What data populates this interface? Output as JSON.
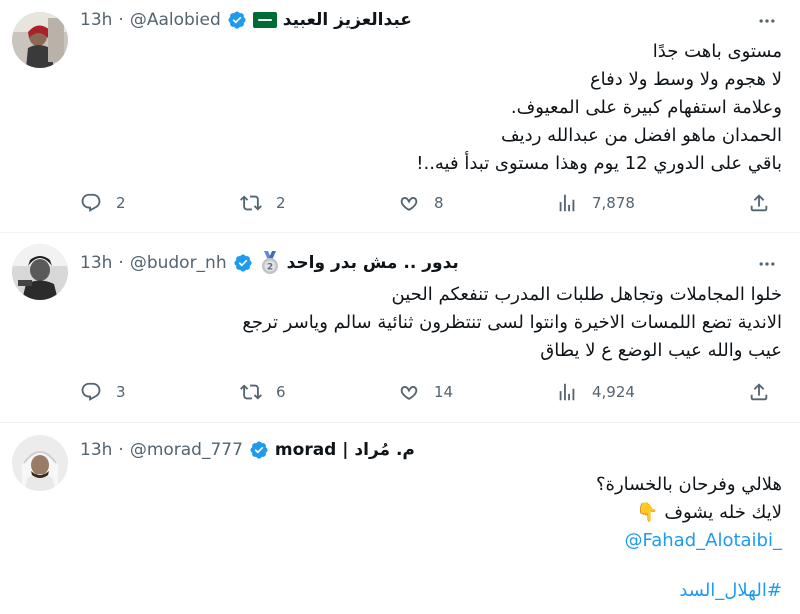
{
  "tweets": [
    {
      "name": "عبدالعزيز العبيد",
      "handle": "@Aalobied",
      "time": "13h",
      "badge": "saudi-flag",
      "lines": [
        "مستوى باهت جدًا",
        "لا هجوم  ولا وسط ولا دفاع",
        "وعلامة استفهام كبيرة على المعيوف.",
        "الحمدان ماهو افضل من عبدالله رديف",
        "باقي على الدوري 12 يوم وهذا مستوى تبدأ فيه..!"
      ],
      "replies": "2",
      "retweets": "2",
      "likes": "8",
      "views": "7,878"
    },
    {
      "name": "بدور .. مش بدر واحد",
      "handle": "@budor_nh",
      "time": "13h",
      "badge": "second-place-medal",
      "lines": [
        "خلوا المجاملات وتجاهل طلبات المدرب تنفعكم الحين",
        "الاندية تضع اللمسات الاخيرة وانتوا لسى تنتظرون ثنائية سالم وياسر ترجع",
        "عيب والله عيب الوضع ع لا يطاق"
      ],
      "replies": "3",
      "retweets": "6",
      "likes": "14",
      "views": "4,924"
    },
    {
      "name": "م. مُراد | morad",
      "handle": "@morad_777",
      "time": "13h",
      "lines": [
        "هلالي وفرحان بالخسارة؟",
        "لايك خله يشوف 👇"
      ],
      "mention": "@Fahad_Alotaibi_",
      "hashtag": "#الهلال_السد"
    }
  ],
  "separator": "·",
  "colors": {
    "verified": "#1d9bf0",
    "link": "#1d9bf0",
    "muted": "#536471",
    "text": "#0f1419",
    "divider": "#eff3f4"
  },
  "icons": [
    "more-icon",
    "reply-icon",
    "retweet-icon",
    "like-icon",
    "views-icon",
    "share-icon",
    "verified-badge-icon"
  ]
}
